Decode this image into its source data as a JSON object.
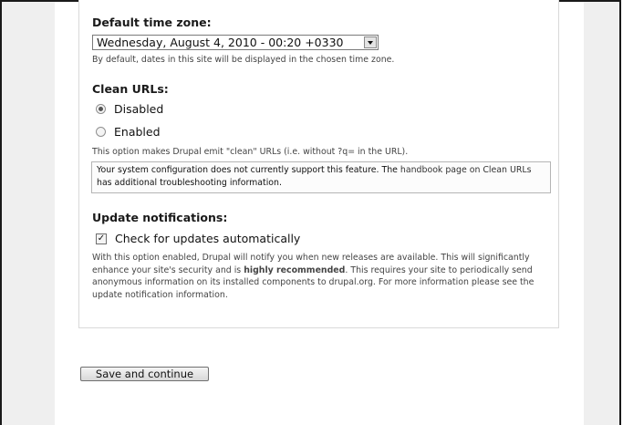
{
  "timezone": {
    "label": "Default time zone:",
    "selected": "Wednesday, August 4, 2010 - 00:20 +0330",
    "description": "By default, dates in this site will be displayed in the chosen time zone."
  },
  "clean_urls": {
    "label": "Clean URLs:",
    "options": [
      {
        "label": "Disabled",
        "selected": true
      },
      {
        "label": "Enabled",
        "selected": false
      }
    ],
    "description": "This option makes Drupal emit \"clean\" URLs (i.e. without ?q= in the URL).",
    "notice_part1": "Your system configuration does not currently support this feature. The ",
    "notice_link": "handbook page on Clean URLs",
    "notice_part2": " has additional troubleshooting information."
  },
  "updates": {
    "label": "Update notifications:",
    "checkbox_label": "Check for updates automatically",
    "checked": true,
    "desc_part1": "With this option enabled, Drupal will notify you when new releases are available. This will significantly enhance your site's security and is ",
    "desc_bold": "highly recommended",
    "desc_part2": ". This requires your site to periodically send anonymous information on its installed components to drupal.org. For more information please see the ",
    "desc_link": "update notification information",
    "desc_part3": "."
  },
  "actions": {
    "save_label": "Save and continue"
  }
}
